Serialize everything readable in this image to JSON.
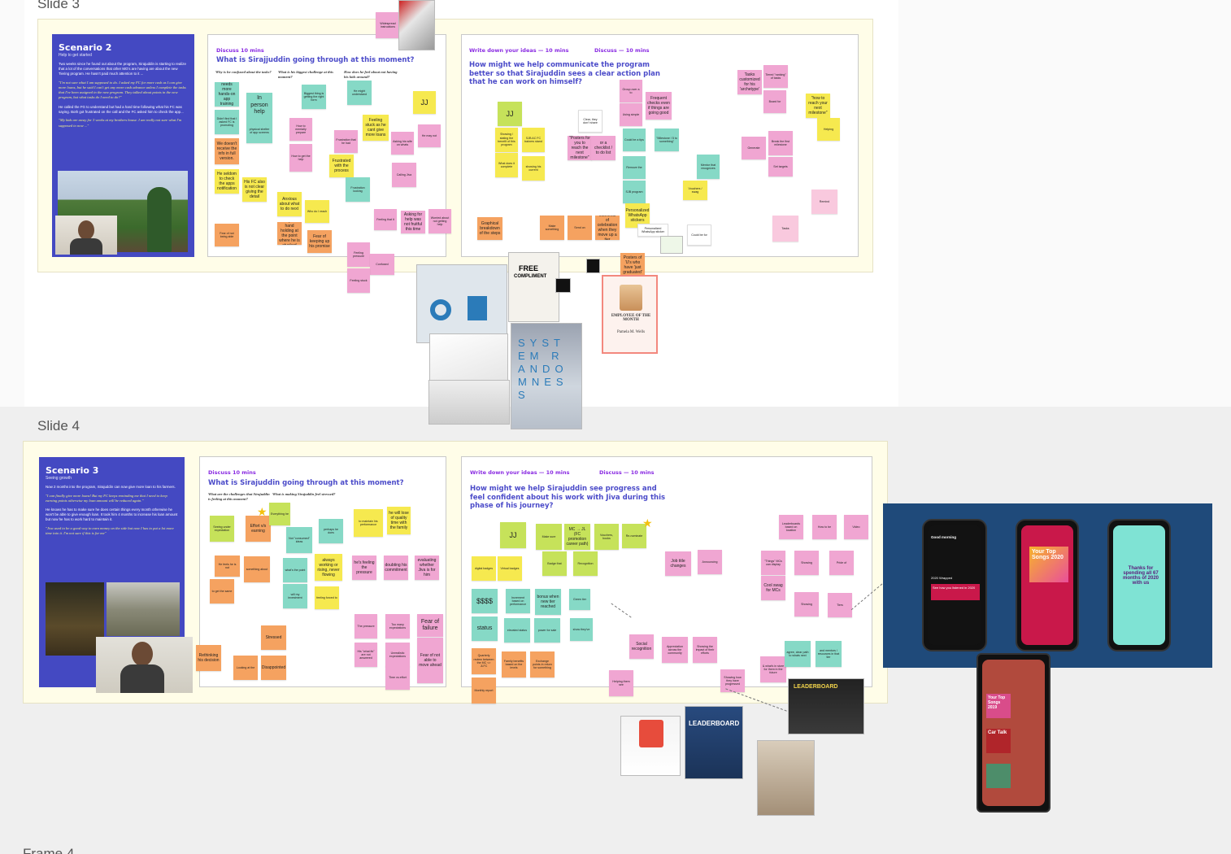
{
  "slide3": {
    "label": "Slide 3",
    "scenario": {
      "title": "Scenario 2",
      "subtitle": "Help to get started",
      "p1": "Two weeks since he found out about the program, Sirajuddin is starting to realize that a lot of the conversations that other MG's are having are about the new Tiering program. He hasn't paid much attention to it ...",
      "q1": "\"I'm not sure what I am supposed to do. I asked my FC for more cash as I can give more loans, but he said I can't get any more cash advance unless I complete the tasks that I've been assigned in the new program. They talked about points in the new program, but what tasks do I need to do?\"",
      "p2": "He called the FG to understand but had a hard time following what his FC was saying. Both got frustrated on the call and the FC asked him to check the app...",
      "q2": "\"My kids are away for 3 weeks at my brothers house. I am really not sure what I'm supposed to now ...\""
    },
    "discuss": {
      "header": "Discuss 10 mins",
      "question": "What is Sirajjuddin going through at this moment?",
      "col1": "Why is he confused about the tasks?",
      "col2": "What is his biggest challenge at this moment?",
      "col3": "How does he feel about not having his kids around?"
    },
    "ideas": {
      "header": "Write down your ideas — 10 mins",
      "header2": "Discuss — 10 mins",
      "question": "How might we help communicate the program better so that Sirajuddin sees a clear action plan that he can work on himself?"
    },
    "notes": {
      "n1": "needs more hands-on app training",
      "n2": "In person help",
      "n3": "JJ",
      "n4": "Feeling stuck as he cant give more loans",
      "n5": "Frustrated with the process",
      "n6": "We doesn't receive the info in full version.",
      "n7": "He seldom to check the apps notification",
      "n8": "His FC also is not clear giving the detail",
      "n9": "Anxious about what to do next",
      "n10": "Require hand holding at the point where he is stucked",
      "n11": "Fear of keeping up his promise",
      "n12": "Asking for help was not fruitful this time",
      "n13": "Graphical breakdown of the steps",
      "n14": "JJ",
      "n15": "\"Posters for you to reach the next milestone\"",
      "n16": "or a checklist / to do list",
      "n17": "Frequent checks even if things are going good",
      "n18": "Personalized WhatsApp stickers",
      "n19": "Posters of 'U's who have 'just graduated'",
      "n20": "Tasks customized for his 'archetype'",
      "n21": "\"how to reach your next milestone\"",
      "n22": "Moments of celebration when they move up a tier"
    },
    "images": {
      "compliment_title": "FREE",
      "compliment_sub": "COMPLIMENT",
      "employee": "EMPLOYEE OF THE MONTH",
      "employee_name": "Pamela M. Wells",
      "sys_letters": "SYSTEM RANDOMNESS"
    }
  },
  "slide4": {
    "label": "Slide 4",
    "scenario": {
      "title": "Scenario 3",
      "subtitle": "Seeing growth",
      "p1": "Now 2 months into the program, Sirajuddin can now give more loan to his farmers.",
      "q1": "\"I can finally give more loans! But my FC keeps reminding me that I need to keep earning points otherwise my loan amount will be reduced again.\"",
      "p2": "He knows he has to make sure he does certain things every month otherwise he won't be able to give enough loan. It took him 4 months to increase his loan amount but now he has to work hard to maintain it.",
      "q2": "\"Jiva used to be a good way to earn money on the side but now I has to put a lot more time into it. I'm not sure if this is for me\""
    },
    "discuss": {
      "header": "Discuss 10 mins",
      "question": "What is Sirajuddin going through at this moment?",
      "col1": "What are the challenges that Sirajuddin is feeling at this moment?",
      "col2": "What is making Sirajuddin feel stressed?"
    },
    "ideas": {
      "header": "Write down your ideas — 10 mins",
      "header2": "Discuss — 10 mins",
      "question": "How might we help Sirajuddin see progress and feel confident about his work with Jiva during this phase of his journey?"
    },
    "notes": {
      "m1": "Effort v/s earning",
      "m2": "he will lose of quality time with the family",
      "m3": "always working or rising, never flowing",
      "m4": "he's feeling the pressure",
      "m5": "Stressed",
      "m6": "Rethinking his decision",
      "m7": "Disappointed",
      "m8": "Fear of failure",
      "m9": "Fear of not able to move ahead",
      "m10": "JJ",
      "m11": "$$$$",
      "m12": "status",
      "m13": "MC → JL (FC promotion career path)",
      "m14": "bonus when new tier reached",
      "m15": "Job title changes",
      "m16": "Cool swag for MCs",
      "m17": "Social recognition",
      "m18": "Appreciation across the community",
      "m19": "Showing the impact of their efforts",
      "m20": "& what's in store for them in the future",
      "m21": "agree, clear path to whats next",
      "m22": "and mentors / resources in that tier",
      "m23": "Family benefits based on the levels",
      "m24": "Exchange points in return for something",
      "m25": "Leaderboards based on location",
      "m26": "Quarterly review between the MC <> JLFC"
    },
    "images": {
      "leaderboard": "LEADERBOARD",
      "leaderboard2": "LEADERBOARD",
      "wrapped_title": "Your Top Songs 2020",
      "wrapped_title2": "2020 Wrapped",
      "thanks": "Thanks for spending all 67 months of 2020 with us",
      "see_how": "See how you listened in 2020",
      "good_morning": "Good morning",
      "car_talk": "Car Talk",
      "top_2019": "Your Top Songs 2019"
    }
  },
  "frame4": {
    "label": "Frame 4"
  },
  "colors": {
    "board_bg": "#efefef",
    "slide_bg": "#fffde8",
    "scenario_bg": "#4449c2",
    "accent_purple": "#8a2be2",
    "question_blue": "#4b4bc9",
    "sticky_yellow": "#f6e94f",
    "sticky_teal": "#86d9c6",
    "sticky_pink": "#f0a6d2",
    "sticky_orange": "#f5a260",
    "sticky_lime": "#c6e25a",
    "phone_panel": "#1f4a7a"
  }
}
